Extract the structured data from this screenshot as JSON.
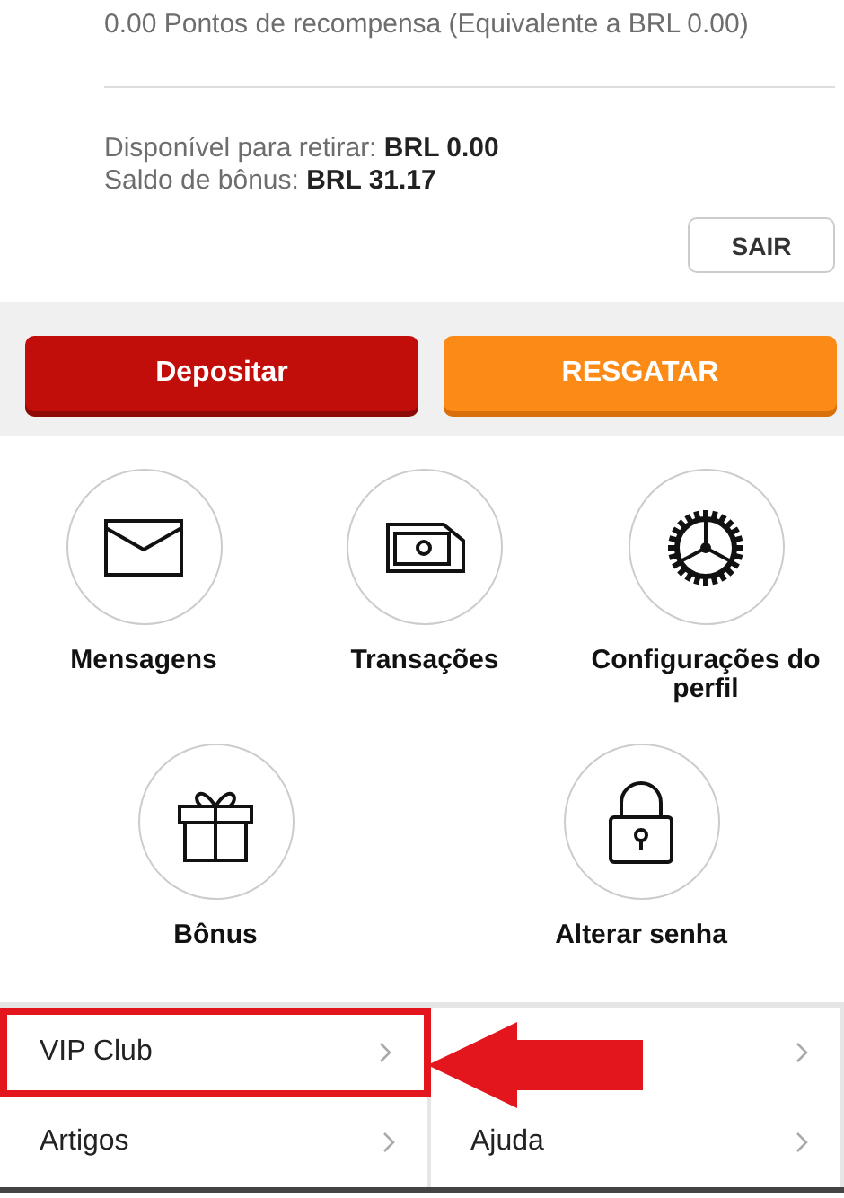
{
  "rewards": {
    "text": "0.00 Pontos de recompensa (Equivalente a BRL 0.00)"
  },
  "balances": [
    {
      "label": "Disponível para retirar:",
      "value": "BRL 0.00"
    },
    {
      "label": "Saldo de bônus:",
      "value": "BRL 31.17"
    }
  ],
  "logout_button": "SAIR",
  "actions": [
    {
      "kind": "deposit",
      "label": "Depositar"
    },
    {
      "kind": "redeem",
      "label": "RESGATAR"
    }
  ],
  "shortcuts": [
    {
      "kind": "mail",
      "label": "Mensagens"
    },
    {
      "kind": "money",
      "label": "Transações"
    },
    {
      "kind": "gear",
      "label": "Configurações do perfil"
    },
    {
      "kind": "gift",
      "label": "Bônus"
    },
    {
      "kind": "lock",
      "label": "Alterar senha"
    }
  ],
  "menu": [
    {
      "label": "VIP Club",
      "highlighted": true
    },
    {
      "highlighted": false
    },
    {
      "label": "Artigos",
      "highlighted": false
    },
    {
      "label": "Ajuda",
      "highlighted": false
    }
  ]
}
